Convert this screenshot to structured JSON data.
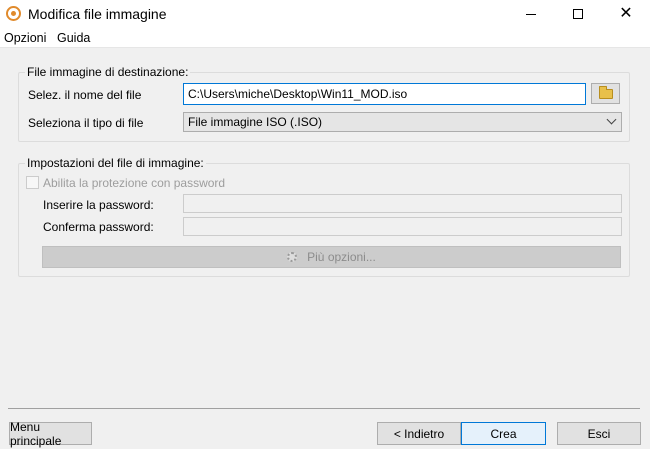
{
  "window": {
    "title": "Modifica file immagine",
    "icon": "disc-icon",
    "controls": {
      "minimize": "minimize-icon",
      "maximize": "maximize-icon",
      "close": "close-icon"
    }
  },
  "menu": {
    "items": [
      "Opzioni",
      "Guida"
    ]
  },
  "destination": {
    "group_title": "File immagine di destinazione:",
    "filename_label": "Selez. il nome del file",
    "filename_value": "C:\\Users\\miche\\Desktop\\Win11_MOD.iso",
    "browse_icon": "folder-icon",
    "filetype_label": "Seleziona il tipo di file",
    "filetype_value": "File immagine ISO (.ISO)"
  },
  "image_settings": {
    "group_title": "Impostazioni del file di immagine:",
    "password_checkbox_label": "Abilita la protezione con password",
    "password_label": "Inserire la password:",
    "confirm_label": "Conferma password:",
    "more_options_label": "Più opzioni...",
    "more_options_icon": "gear-icon"
  },
  "footer": {
    "main_menu": "Menu principale",
    "back": "< Indietro",
    "create": "Crea",
    "exit": "Esci"
  },
  "colors": {
    "accent": "#0078d7",
    "app_icon": "#e08a2c"
  }
}
